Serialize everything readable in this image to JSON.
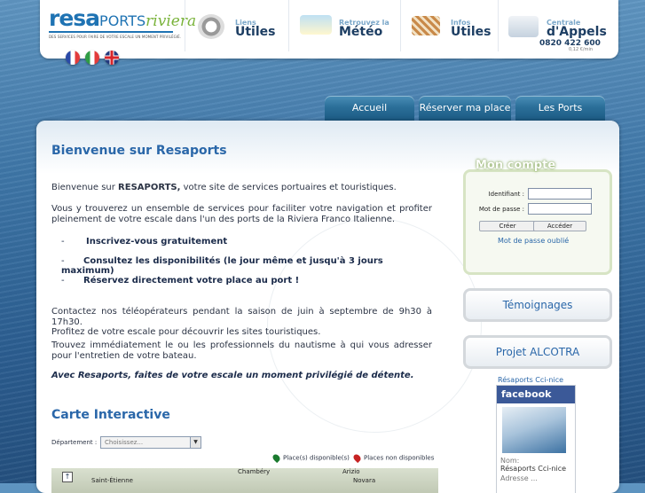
{
  "header": {
    "logo": {
      "brand": "resa",
      "brand2": "PORTS",
      "sub": "riviera",
      "tagline": "DES SERVICES POUR FAIRE DE VOTRE ESCALE UN MOMENT PRIVILÉGIÉ."
    },
    "items": [
      {
        "small": "Liens",
        "big": "Utiles"
      },
      {
        "small": "Retrouvez la",
        "big": "Météo"
      },
      {
        "small": "Infos",
        "big": "Utiles"
      },
      {
        "small": "Centrale",
        "big": "d'Appels",
        "phone": "0820 422 600",
        "price": "0,12 €/min"
      }
    ],
    "languages": [
      "fr-flag",
      "it-flag",
      "en-flag"
    ]
  },
  "nav": [
    "Accueil",
    "Réserver ma place",
    "Les Ports"
  ],
  "main": {
    "title": "Bienvenue sur Resaports",
    "intro_prefix": "Bienvenue sur ",
    "intro_bold": "RESAPORTS,",
    "intro_suffix": " votre site de services portuaires et touristiques.",
    "para2": "Vous y trouverez un ensemble de services pour faciliter votre navigation et profiter pleinement de votre escale dans l'un des ports de la Riviera Franco Italienne.",
    "bullets": [
      "Inscrivez-vous gratuitement",
      "Consultez les disponibilités (le jour même et jusqu'à 3 jours maximum)",
      "Réservez directement votre place au port !"
    ],
    "bullet_dash": "-",
    "contact": "Contactez nos téléopérateurs pendant la saison de juin à septembre de 9h30 à 17h30.",
    "para3": "Profitez de votre escale pour découvrir les sites touristiques.",
    "para4": "Trouvez immédiatement le ou les professionnels du nautisme à qui vous adresser pour l'entretien de votre bateau.",
    "closing": "Avec Resaports, faites de votre escale un moment privilégié de détente.",
    "carte_title": "Carte Interactive",
    "dept_label": "Département :",
    "dept_value": "Choisissez...",
    "legend_free": "Place(s) disponible(s)",
    "legend_none": "Places non disponibles",
    "map_cities": [
      "Chambéry",
      "Saint-Étienne",
      "Arizio",
      "Novara"
    ]
  },
  "account": {
    "title": "Mon compte",
    "id_label": "Identifiant :",
    "pw_label": "Mot de passe :",
    "create": "Créer",
    "access": "Accéder",
    "forgot": "Mot de passe oublié"
  },
  "sidebar": {
    "testimonials": "Témoignages",
    "alcotra": "Projet ALCOTRA",
    "fb_title": "Résaports Cci-nice",
    "fb_brand": "facebook",
    "fb_name_label": "Nom:",
    "fb_name": "Résaports Cci-nice",
    "fb_addr": "Adresse ..."
  },
  "colors": {
    "accent": "#2a67a9",
    "tab": "#2b6f99",
    "green": "#7ab33b"
  }
}
